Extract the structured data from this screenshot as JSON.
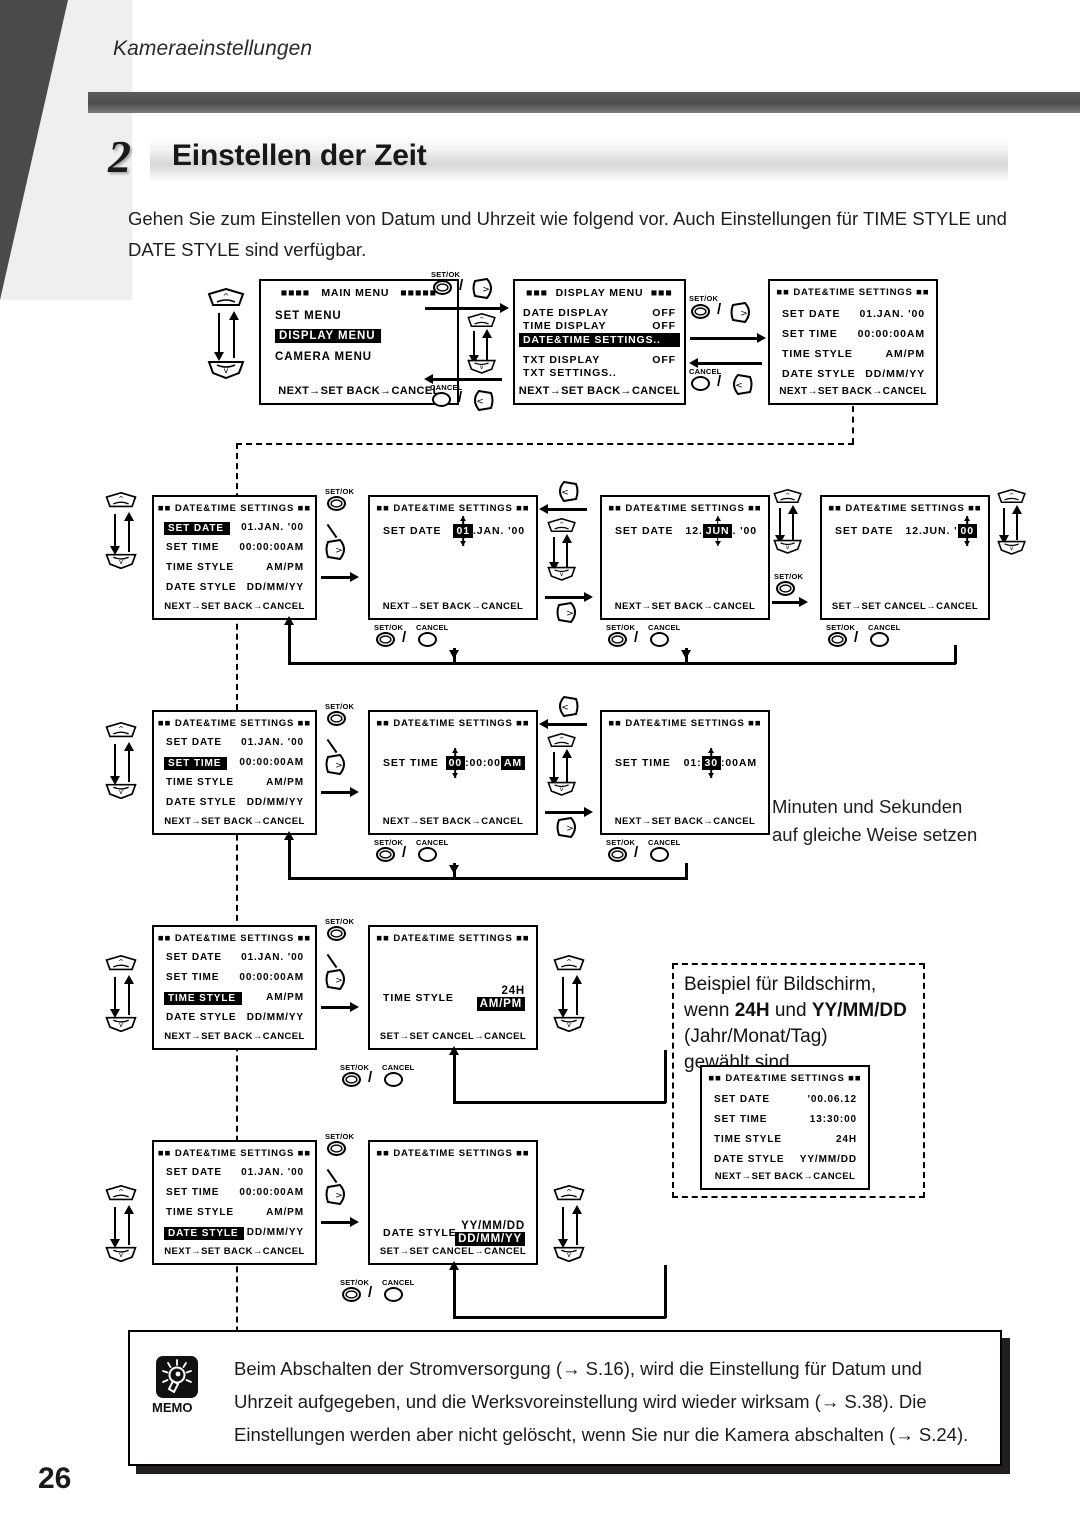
{
  "header": {
    "running_title": "Kameraeinstellungen",
    "section_number": "2",
    "section_title": "Einstellen der Zeit"
  },
  "intro": "Gehen Sie zum Einstellen von Datum und Uhrzeit wie folgend vor. Auch Einstellungen für TIME STYLE und DATE STYLE sind verfügbar.",
  "page_number": "26",
  "labels": {
    "set_ok": "SET/OK",
    "cancel": "CANCEL",
    "slash": "/",
    "next_set": "NEXT→SET   BACK→CANCEL",
    "set_set": "SET→SET  CANCEL→CANCEL"
  },
  "screens": {
    "main_menu": {
      "title": "MAIN  MENU",
      "title_blocks_left": "■■■■",
      "title_blocks_right": "■■■■■",
      "items": [
        "SET MENU",
        "DISPLAY MENU",
        "CAMERA MENU"
      ],
      "selected": "DISPLAY MENU",
      "footer": "NEXT→SET   BACK→CANCEL"
    },
    "display_menu": {
      "title": "DISPLAY MENU",
      "title_blocks_left": "■■■",
      "title_blocks_right": "■■■",
      "rows": [
        {
          "label": "DATE DISPLAY",
          "value": "OFF"
        },
        {
          "label": "TIME DISPLAY",
          "value": "OFF"
        },
        {
          "label": "DATE&TIME SETTINGS..",
          "value": ""
        },
        {
          "label": "TXT DISPLAY",
          "value": "OFF"
        },
        {
          "label": "TXT SETTINGS..",
          "value": ""
        }
      ],
      "selected": "DATE&TIME SETTINGS..",
      "footer": "NEXT→SET   BACK→CANCEL"
    },
    "datetime_settings": {
      "title": "DATE&TIME SETTINGS",
      "title_blocks": "■■",
      "rows": [
        {
          "label": "SET DATE",
          "value": "01.JAN. '00"
        },
        {
          "label": "SET TIME",
          "value": "00:00:00AM"
        },
        {
          "label": "TIME STYLE",
          "value": "AM/PM"
        },
        {
          "label": "DATE STYLE",
          "value": "DD/MM/YY"
        }
      ],
      "footer": "NEXT→SET   BACK→CANCEL"
    },
    "edit_date_day": {
      "label": "SET DATE",
      "value_pre": "",
      "value_cursor": "01",
      "value_post": ".JAN. '00",
      "footer": "NEXT→SET   BACK→CANCEL"
    },
    "edit_date_month": {
      "label": "SET DATE",
      "value_pre": "12.",
      "value_cursor": "JUN",
      "value_post": ". '00",
      "footer": "NEXT→SET   BACK→CANCEL"
    },
    "edit_date_year": {
      "label": "SET DATE",
      "value_pre": "12.JUN. '",
      "value_cursor": "00",
      "value_post": "",
      "footer": "SET→SET  CANCEL→CANCEL"
    },
    "edit_time_hour": {
      "label": "SET TIME",
      "value_pre": "",
      "value_cursor": "00",
      "value_post": ":00:00",
      "value_ampm": "AM",
      "footer": "NEXT→SET   BACK→CANCEL"
    },
    "edit_time_min": {
      "label": "SET TIME",
      "value_pre": "01:",
      "value_cursor": "30",
      "value_post": ":00AM",
      "footer": "NEXT→SET   BACK→CANCEL"
    },
    "edit_time_style": {
      "label": "TIME STYLE",
      "option_top": "24H",
      "option_bottom": "AM/PM",
      "selected": "AM/PM",
      "footer": "SET→SET  CANCEL→CANCEL"
    },
    "edit_date_style": {
      "label": "DATE STYLE",
      "option_top": "YY/MM/DD",
      "option_bottom": "DD/MM/YY",
      "selected": "DD/MM/YY",
      "footer": "SET→SET  CANCEL→CANCEL"
    },
    "example": {
      "title": "DATE&TIME SETTINGS",
      "title_blocks": "■■",
      "rows": [
        {
          "label": "SET DATE",
          "value": "'00.06.12"
        },
        {
          "label": "SET TIME",
          "value": "13:30:00"
        },
        {
          "label": "TIME STYLE",
          "value": "24H"
        },
        {
          "label": "DATE STYLE",
          "value": "YY/MM/DD"
        }
      ],
      "footer": "NEXT→SET   BACK→CANCEL"
    },
    "menu_rows_select_date": {
      "selected": "SET DATE"
    },
    "menu_rows_select_time": {
      "selected": "SET TIME"
    },
    "menu_rows_select_tstyle": {
      "selected": "TIME STYLE"
    },
    "menu_rows_select_dstyle": {
      "selected": "DATE STYLE"
    }
  },
  "notes": {
    "minutes_seconds": "Minuten und Sekunden\nauf gleiche Weise setzen",
    "example_line1": "Beispiel für Bildschirm,",
    "example_line2_a": "wenn ",
    "example_line2_b": "24H",
    "example_line2_c": " und ",
    "example_line2_d": "YY/MM/DD",
    "example_line3": "(Jahr/Monat/Tag)",
    "example_line4": "gewählt sind"
  },
  "memo": {
    "icon": "lightbulb-icon",
    "label": "MEMO",
    "text": "Beim Abschalten der Stromversorgung (→ S.16), wird die Einstellung für Datum und Uhrzeit aufgegeben, und die Werksvoreinstellung wird wieder wirksam (→ S.38). Die Einstellungen werden aber nicht gelöscht, wenn Sie nur die Kamera abschalten (→ S.24)."
  }
}
